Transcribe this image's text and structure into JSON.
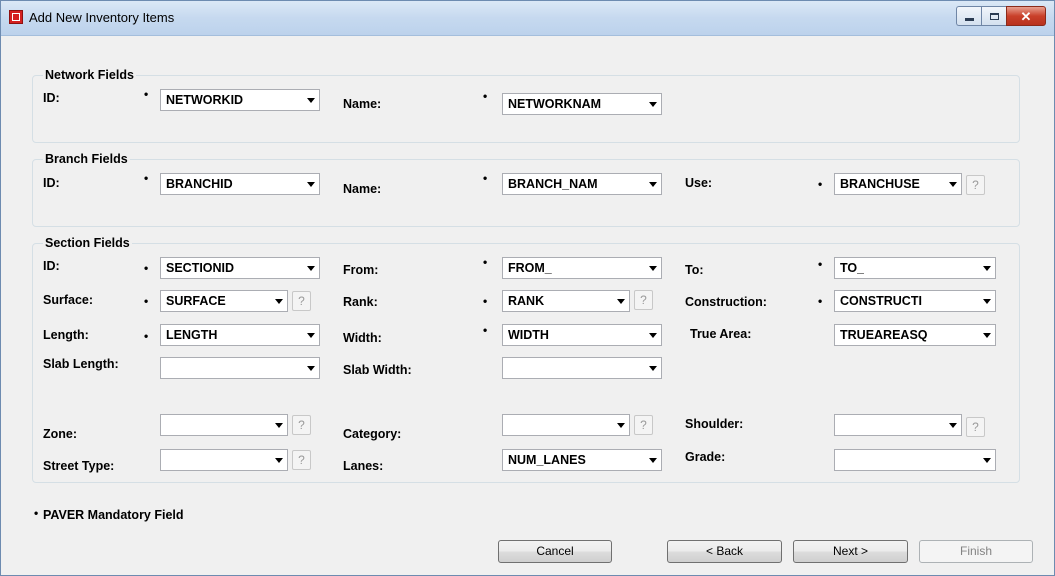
{
  "window": {
    "title": "Add New Inventory Items",
    "close_glyph": "✕"
  },
  "network": {
    "title": "Network Fields",
    "id_label": "ID:",
    "id_value": "NETWORKID",
    "name_label": "Name:",
    "name_value": "NETWORKNAM"
  },
  "branch": {
    "title": "Branch Fields",
    "id_label": "ID:",
    "id_value": "BRANCHID",
    "name_label": "Name:",
    "name_value": "BRANCH_NAM",
    "use_label": "Use:",
    "use_value": "BRANCHUSE"
  },
  "section": {
    "title": "Section Fields",
    "id_label": "ID:",
    "id_value": "SECTIONID",
    "from_label": "From:",
    "from_value": "FROM_",
    "to_label": "To:",
    "to_value": "TO_",
    "surface_label": "Surface:",
    "surface_value": "SURFACE",
    "rank_label": "Rank:",
    "rank_value": "RANK",
    "construction_label": "Construction:",
    "construction_value": "CONSTRUCTI",
    "length_label": "Length:",
    "length_value": "LENGTH",
    "width_label": "Width:",
    "width_value": "WIDTH",
    "truearea_label": "True Area:",
    "truearea_value": "TRUEAREASQ",
    "slablength_label": "Slab Length:",
    "slablength_value": "",
    "slabwidth_label": "Slab Width:",
    "slabwidth_value": "",
    "zone_label": "Zone:",
    "zone_value": "",
    "category_label": "Category:",
    "category_value": "",
    "shoulder_label": "Shoulder:",
    "shoulder_value": "",
    "streettype_label": "Street Type:",
    "streettype_value": "",
    "lanes_label": "Lanes:",
    "lanes_value": "NUM_LANES",
    "grade_label": "Grade:",
    "grade_value": ""
  },
  "mandatory_mark": "•",
  "help_label": "?",
  "footnote": "PAVER Mandatory Field",
  "buttons": {
    "cancel": "Cancel",
    "back": "< Back",
    "next": "Next >",
    "finish": "Finish"
  }
}
